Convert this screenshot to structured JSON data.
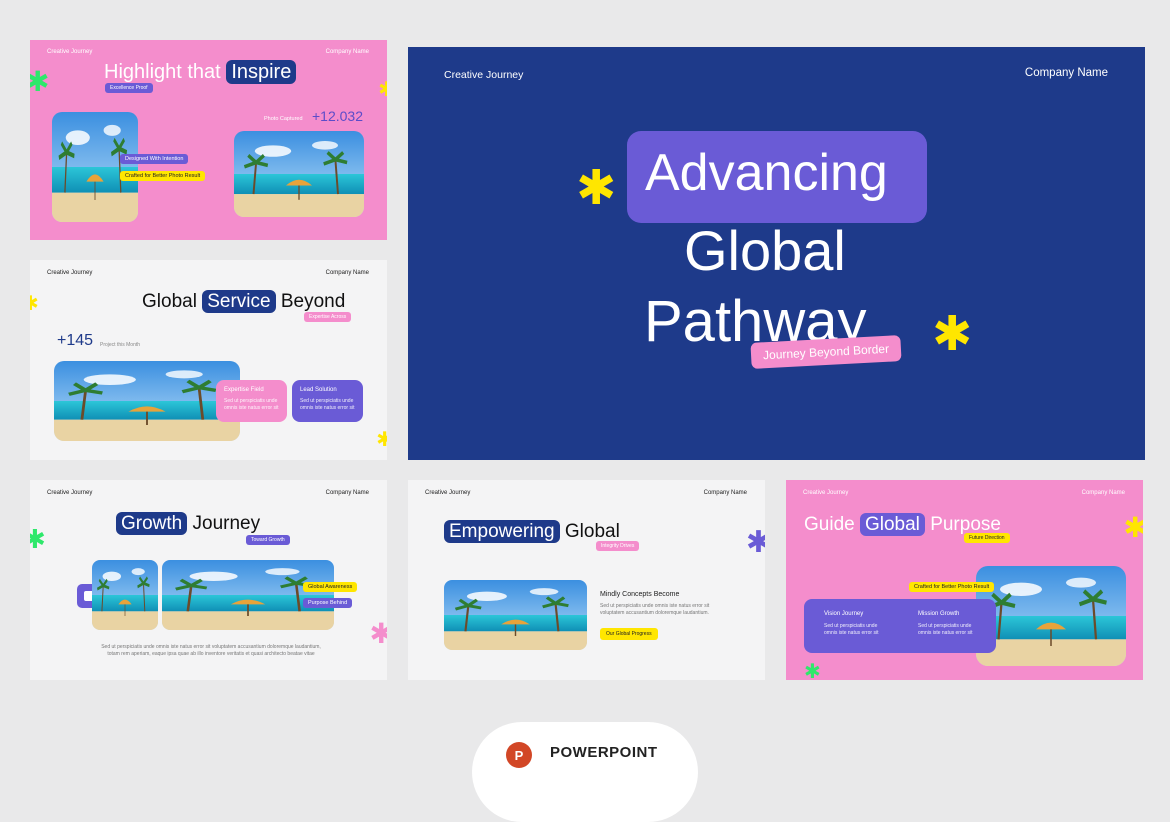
{
  "colors": {
    "pink": "#f48dcc",
    "navy": "#1e3a8a",
    "purple": "#6a5bd6",
    "yellow": "#ffe600",
    "green": "#2ee86b",
    "light": "#f4f4f5"
  },
  "slide1": {
    "brand": "Creative Journey",
    "company": "Company Name",
    "title_a": "Highlight that",
    "title_b": "Inspire",
    "badge": "Excellence Proof",
    "caption": "Photo Captured",
    "number": "+12.032",
    "tag1": "Designed With Intention",
    "tag2": "Crafted for Better Photo Result"
  },
  "slide2": {
    "brand": "Creative Journey",
    "company": "Company Name",
    "title_a": "Global",
    "title_b": "Service",
    "title_c": "Beyond",
    "badge": "Expertise Across",
    "number": "+145",
    "number_caption": "Project this Month",
    "card1_title": "Expertise Field",
    "card1_body": "Sed ut perspiciatis unde omnis iste natus error sit",
    "card2_title": "Lead Solution",
    "card2_body": "Sed ut perspiciatis unde omnis iste natus error sit"
  },
  "hero": {
    "brand": "Creative Journey",
    "company": "Company Name",
    "line1": "Advancing",
    "line2": "Global",
    "line3": "Pathway",
    "badge": "Journey Beyond Border"
  },
  "slide4": {
    "brand": "Creative Journey",
    "company": "Company Name",
    "title_a": "Growth",
    "title_b": "Journey",
    "badge": "Toward Growth",
    "tag1": "Global Awareness",
    "tag2": "Purpose Behind",
    "body": "Sed ut perspiciatis unde omnis iste natus error sit voluptatem accusantium doloremque laudantium, totam rem aperiam, eaque ipsa quae ab illo inventore veritatis et quasi architecto beatae vitae"
  },
  "slide5": {
    "brand": "Creative Journey",
    "company": "Company Name",
    "title_a": "Empowering",
    "title_b": "Global",
    "badge": "Integrity Drives",
    "heading": "Mindly Concepts Become",
    "body": "Sed ut perspiciatis unde omnis iste natus error sit voluptatem accusantium doloremque laudantium.",
    "button": "Our Global Progress"
  },
  "slide6": {
    "brand": "Creative Journey",
    "company": "Company Name",
    "title_a": "Guide",
    "title_b": "Global",
    "title_c": "Purpose",
    "badge": "Future Direction",
    "tag": "Crafted for Better Photo Result",
    "col1_title": "Vision Journey",
    "col1_body": "Sed ut perspiciatis unde omnis iste natus error sit",
    "col2_title": "Mission Growth",
    "col2_body": "Sed ut perspiciatis unde omnis iste natus error sit"
  },
  "footer": {
    "label": "POWERPOINT",
    "icon": "powerpoint-icon",
    "icon_letter": "P"
  }
}
